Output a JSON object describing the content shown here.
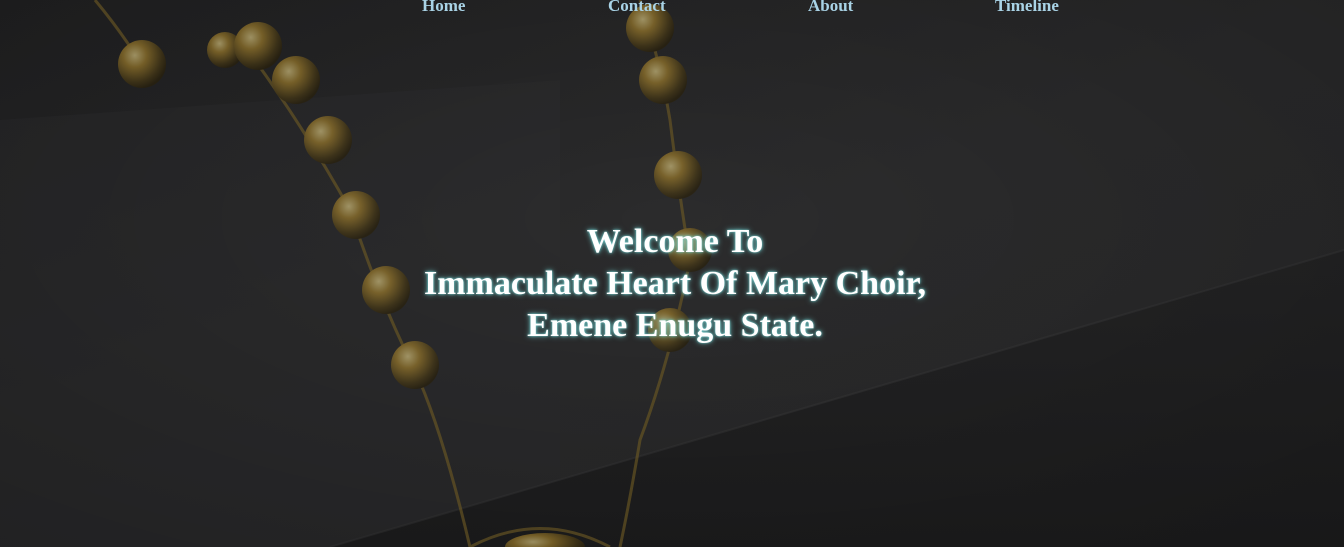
{
  "nav": {
    "items": [
      {
        "label": "Home"
      },
      {
        "label": "Contact"
      },
      {
        "label": "About"
      },
      {
        "label": "Timeline"
      }
    ]
  },
  "hero": {
    "line1": "Welcome To",
    "line2": "Immaculate Heart Of Mary Choir,",
    "line3": "Emene Enugu State."
  },
  "colors": {
    "nav_text": "#a9d3e6",
    "hero_text": "#ffffff",
    "background": "#2a2a2b",
    "text_glow": "#78dcdc",
    "beads": "#8a6a1e"
  }
}
